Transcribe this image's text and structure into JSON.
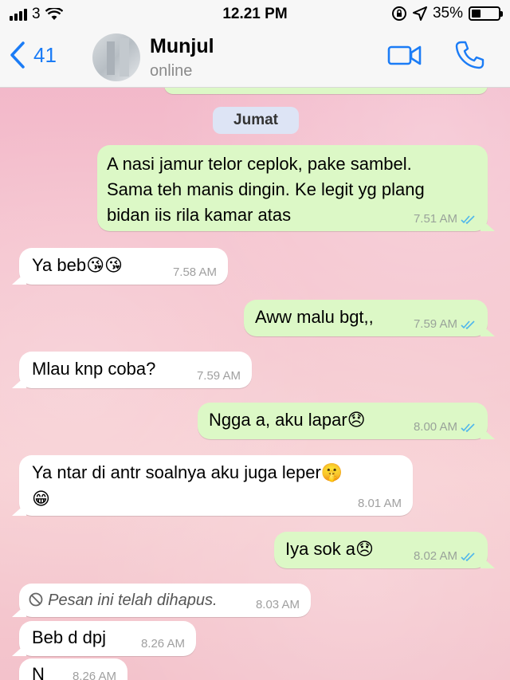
{
  "status_bar": {
    "carrier": "3",
    "time": "12.21 PM",
    "battery": "35%",
    "battery_level": 0.35
  },
  "header": {
    "back_count": "41",
    "contact_name": "Munjul",
    "contact_status": "online"
  },
  "date_divider": "Jumat",
  "messages": [
    {
      "dir": "out",
      "text_lines": [
        "A nasi jamur telor ceplok, pake sambel.",
        "Sama teh manis dingin. Ke legit yg plang",
        "bidan iis rila kamar atas"
      ],
      "time": "7.51 AM",
      "read": true
    },
    {
      "dir": "in",
      "text": "Ya beb",
      "emoji": "😘😘",
      "time": "7.58 AM"
    },
    {
      "dir": "out",
      "text": "Aww malu bgt,,",
      "time": "7.59 AM",
      "read": true
    },
    {
      "dir": "in",
      "text": "Mlau knp coba?",
      "time": "7.59 AM"
    },
    {
      "dir": "out",
      "text": "Ngga a, aku lapar",
      "emoji": "😞",
      "time": "8.00 AM",
      "read": true
    },
    {
      "dir": "in",
      "text": "Ya ntar di antr soalnya aku juga leper",
      "emoji": "🤫",
      "emoji2": "😁",
      "time": "8.01 AM"
    },
    {
      "dir": "out",
      "text": "Iya sok a",
      "emoji": "😞",
      "time": "8.02 AM",
      "read": true
    },
    {
      "dir": "in",
      "text": "Pesan ini telah dihapus.",
      "deleted": true,
      "time": "8.03 AM"
    },
    {
      "dir": "in",
      "text": "Beb d dpj",
      "time": "8.26 AM"
    },
    {
      "dir": "in",
      "text": "N",
      "time": "8.26 AM"
    }
  ]
}
